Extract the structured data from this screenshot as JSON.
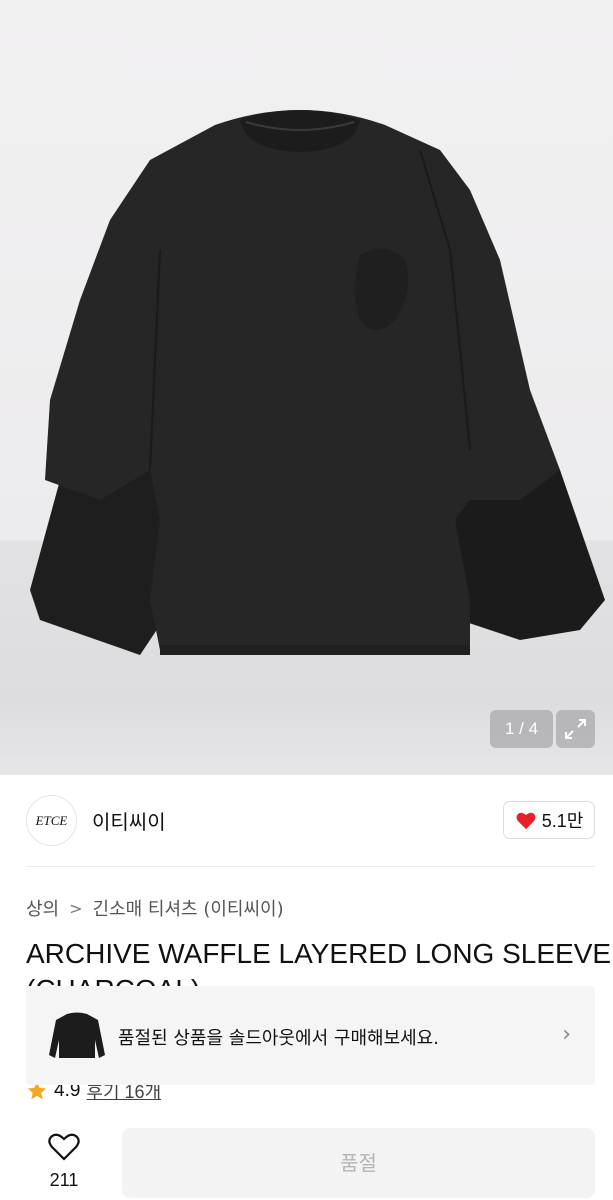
{
  "header": {
    "icons": [
      "shopping-bag-icon",
      "search-icon"
    ]
  },
  "gallery": {
    "counter": "1 / 4",
    "expand_icon": "expand-icon"
  },
  "brand": {
    "logo_text": "ETCE",
    "name": "이티씨이",
    "likes": "5.1만",
    "heart_color": "#e8202a"
  },
  "breadcrumb": {
    "items": [
      "상의",
      "긴소매 티셔츠 (이티씨이)"
    ]
  },
  "product": {
    "title": "ARCHIVE WAFFLE LAYERED LONG SLEEVE",
    "title_line2": "(CHARCOAL)",
    "rating": "4.9",
    "reviews": "후기 16개"
  },
  "soldout_banner": {
    "text": "품절된 상품을 솔드아웃에서 구매해보세요."
  },
  "bottom_bar": {
    "wish_count": "211",
    "button_label": "품절"
  },
  "colors": {
    "star": "#f5a623",
    "disabled_text": "#b4b4b4"
  }
}
